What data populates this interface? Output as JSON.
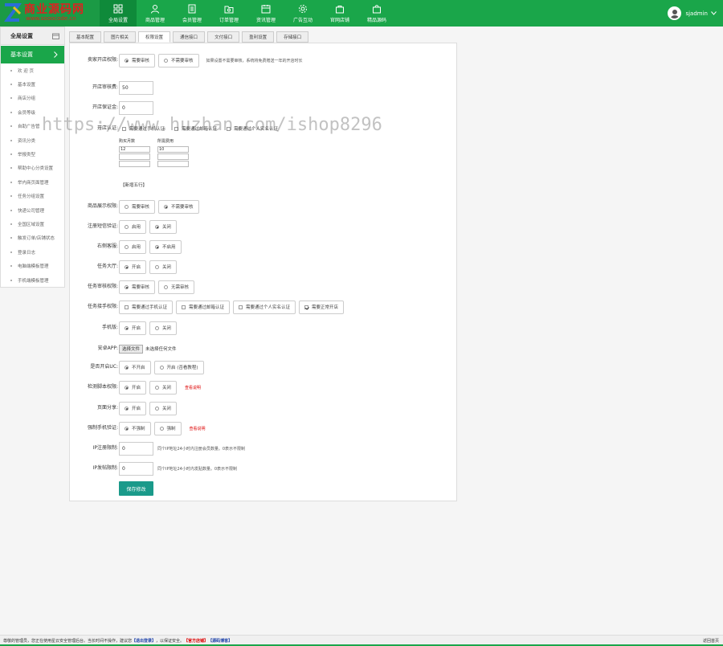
{
  "brand": {
    "name_cn": "商业源码网",
    "name_en": "www.sooocode.cn"
  },
  "nav": [
    {
      "label": "全局设置",
      "icon": "grid-icon",
      "active": true
    },
    {
      "label": "商品管理",
      "icon": "user-icon"
    },
    {
      "label": "会员管理",
      "icon": "document-icon"
    },
    {
      "label": "订单管理",
      "icon": "folder-icon"
    },
    {
      "label": "资讯管理",
      "icon": "calendar-icon"
    },
    {
      "label": "广告互动",
      "icon": "gear-icon"
    },
    {
      "label": "官网店铺",
      "icon": "bag-icon"
    },
    {
      "label": "精品源码",
      "icon": "shop-icon"
    }
  ],
  "user": {
    "name": "sjadmin"
  },
  "sidebar": {
    "title": "全局设置",
    "group": "基本设置",
    "items": [
      "欢 迎 页",
      "基本设置",
      "商店分组",
      "会员等级",
      "自助广告管",
      "资讯分类",
      "举报类型",
      "帮助中心分类设置",
      "举内商页面管理",
      "任务分组设置",
      "快递公司管理",
      "全国区域设置",
      "触发订单/店铺状态",
      "登录日志",
      "电脑端模板管理",
      "手机端模板管理"
    ]
  },
  "tabs": [
    "基本配置",
    "图片相关",
    "权限设置",
    "通信接口",
    "文付接口",
    "盈利设置",
    "存储接口"
  ],
  "active_tab": "权限设置",
  "form": {
    "open_shop": {
      "label": "卖家开店权限:",
      "opt1": "需要审核",
      "opt2": "不需要审核",
      "note": "如果设置不需要审核，系统将免费赠送一年的开店时长"
    },
    "audit_fee": {
      "label": "开店审核费:",
      "value": "50"
    },
    "deposit": {
      "label": "开店保证金:",
      "value": "0"
    },
    "fee_setting": {
      "label": "开店认证:",
      "opt1": "需要通过手机认证",
      "opt2": "需要通过邮箱认证",
      "opt3": "需要通过个人实名认证",
      "col1": "购买月数",
      "col2": "所需费用",
      "r1c1": "12",
      "r1c2": "10",
      "add": "【新增五行】"
    },
    "goods_show": {
      "label": "商品展示权限:",
      "opt1": "需要审核",
      "opt2": "不需要审核"
    },
    "reg_sms": {
      "label": "注册短信验证:",
      "opt1": "启用",
      "opt2": "关闭"
    },
    "right_click": {
      "label": "右侧客服:",
      "opt1": "启用",
      "opt2": "不启用"
    },
    "task_hall": {
      "label": "任务大厅:",
      "opt1": "开启",
      "opt2": "关闭"
    },
    "task_audit": {
      "label": "任务审核权限:",
      "opt1": "需要审核",
      "opt2": "无需审核"
    },
    "task_accept": {
      "label": "任务接手权限:",
      "opt1": "需要通过手机认证",
      "opt2": "需要通过邮箱认证",
      "opt3": "需要通过个人实名认证",
      "opt4": "需要正常开店"
    },
    "mobile": {
      "label": "手机版:",
      "opt1": "开启",
      "opt2": "关闭"
    },
    "android": {
      "label": "安卓APP:",
      "btn": "选择文件",
      "text": "未选择任何文件"
    },
    "uc": {
      "label": "是否开启UC:",
      "opt1": "不开启",
      "opt2": "开启 (否看教程)"
    },
    "detect": {
      "label": "检测脚本权限:",
      "opt1": "开启",
      "opt2": "关闭",
      "warn": "查看说明"
    },
    "share": {
      "label": "页面分享:",
      "opt1": "开启",
      "opt2": "关闭"
    },
    "bind_mobile": {
      "label": "强制手机验证:",
      "opt1": "不强制",
      "opt2": "强制",
      "warn": "查看说明"
    },
    "ip_reg": {
      "label": "IP注册限制:",
      "value": "0",
      "note": "同个IP地址24小时内注册会员数量。0表示不限制"
    },
    "ip_post": {
      "label": "IP发帖限制:",
      "value": "0",
      "note": "同个IP地址24小时内发贴数量。0表示不限制"
    },
    "save": "保存修改"
  },
  "watermark": "https://www.huzhan.com/ishop8296",
  "footer": {
    "text": "尊敬的管理员，您正在使用星云安全管理后台。当长时间不操作，建议您",
    "logout": "【退出登录】",
    "mid": "，以保证安全。",
    "link1": "【官方店铺】",
    "link2": "【源码博客】",
    "right": "返回首页"
  }
}
